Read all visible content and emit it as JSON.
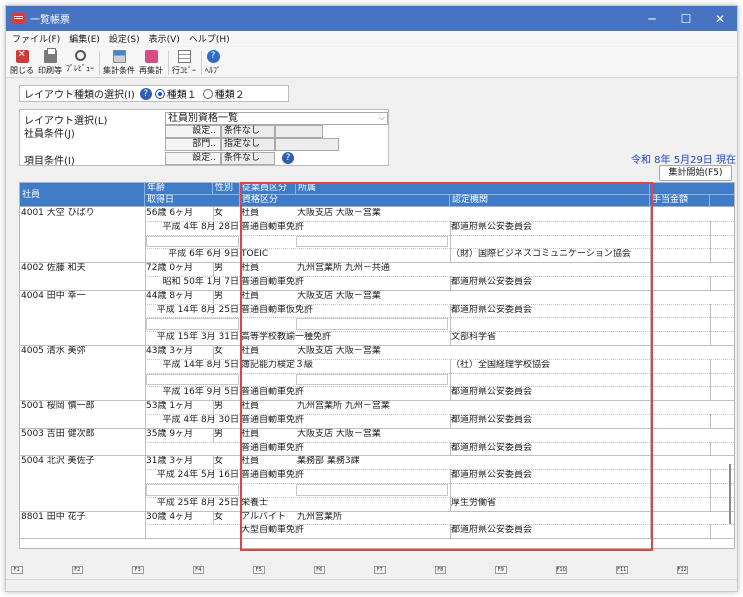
{
  "window": {
    "title": "一覧帳票",
    "controls": [
      "─",
      "☐",
      "✕"
    ]
  },
  "menu": [
    "ファイル(F)",
    "編集(E)",
    "設定(S)",
    "表示(V)",
    "ヘルプ(H)"
  ],
  "toolbar": [
    {
      "label": "閉じる",
      "icon": "close-icon"
    },
    {
      "label": "印刷等",
      "icon": "printer-icon"
    },
    {
      "label": "ﾌﾟﾚﾋﾞｭｰ",
      "icon": "magnifier-icon"
    },
    {
      "label": "集計条件",
      "icon": "summary-icon"
    },
    {
      "label": "再集計",
      "icon": "recalc-icon"
    },
    {
      "label": "行ｺﾋﾟｰ",
      "icon": "rowcopy-icon"
    },
    {
      "label": "ﾍﾙﾌﾟ",
      "icon": "help-icon"
    }
  ],
  "layout_type": {
    "label": "レイアウト種類の選択(I)",
    "help": "?",
    "options": [
      {
        "label": "種類１",
        "selected": true
      },
      {
        "label": "種類２",
        "selected": false
      }
    ]
  },
  "form": {
    "layout_select_label": "レイアウト選択(L)",
    "layout_select_value": "社員別資格一覧",
    "employee_cond_label": "社員条件(J)",
    "setting_btn": "設定..",
    "employee_cond_value": "条件なし",
    "dept_btn": "部門..",
    "dept_value": "指定なし",
    "item_cond_label": "項目条件(I)",
    "item_setting_btn": "設定..",
    "item_cond_value": "条件なし",
    "help": "?"
  },
  "date": "令和 8年 5月29日 現在",
  "run_button": "集計開始(F5)",
  "grid": {
    "headers": {
      "employee": "社員",
      "age": "年齢",
      "gender": "性別",
      "emp_type": "従業員区分",
      "affiliation": "所属",
      "acquired": "取得日",
      "qual": "資格区分",
      "authority": "認定機関",
      "allowance": "手当金額"
    },
    "rows": [
      {
        "employee": "4001 大空 ひばり",
        "age": "56歳  6ヶ月",
        "gender": "女",
        "type": "社員",
        "aff": "大阪支店 大阪－営業",
        "quals": [
          {
            "date": "平成  4年  8月 28日",
            "qual": "普通自動車免許",
            "auth": "都道府県公安委員会"
          },
          {
            "date": "",
            "qual": "",
            "auth": ""
          },
          {
            "date": "平成  6年  6月  9日",
            "qual": "TOEIC",
            "auth": "（財）国際ビジネスコミュニケーション協会"
          }
        ]
      },
      {
        "employee": "4002 佐藤 和夫",
        "age": "72歳  0ヶ月",
        "gender": "男",
        "type": "社員",
        "aff": "九州営業所 九州－共通",
        "quals": [
          {
            "date": "昭和 50年  1月  7日",
            "qual": "普通自動車免許",
            "auth": "都道府県公安委員会"
          }
        ]
      },
      {
        "employee": "4004 田中 幸一",
        "age": "44歳  8ヶ月",
        "gender": "男",
        "type": "社員",
        "aff": "大阪支店 大阪－営業",
        "quals": [
          {
            "date": "平成 14年  8月 25日",
            "qual": "普通自動車仮免許",
            "auth": "都道府県公安委員会"
          },
          {
            "date": "",
            "qual": "",
            "auth": ""
          },
          {
            "date": "平成 15年  3月 31日",
            "qual": "高等学校教諭一種免許",
            "auth": "文部科学省"
          }
        ]
      },
      {
        "employee": "4005 清水 美弥",
        "age": "43歳  3ヶ月",
        "gender": "女",
        "type": "社員",
        "aff": "大阪支店 大阪－営業",
        "quals": [
          {
            "date": "平成 14年  8月  5日",
            "qual": "簿記能力検定３級",
            "auth": "（社）全国経理学校協会"
          },
          {
            "date": "",
            "qual": "",
            "auth": ""
          },
          {
            "date": "平成 16年  9月  5日",
            "qual": "普通自動車免許",
            "auth": "都道府県公安委員会"
          }
        ]
      },
      {
        "employee": "5001 桜岡 慎一郎",
        "age": "53歳  1ヶ月",
        "gender": "男",
        "type": "社員",
        "aff": "九州営業所 九州－営業",
        "quals": [
          {
            "date": "平成  4年  8月 30日",
            "qual": "普通自動車免許",
            "auth": "都道府県公安委員会"
          }
        ]
      },
      {
        "employee": "5003 吉田 健次郎",
        "age": "35歳  9ヶ月",
        "gender": "男",
        "type": "社員",
        "aff": "大阪支店 大阪－営業",
        "quals": [
          {
            "date": "",
            "qual": "普通自動車免許",
            "auth": "都道府県公安委員会"
          }
        ]
      },
      {
        "employee": "5004 北沢 美佐子",
        "age": "31歳  3ヶ月",
        "gender": "女",
        "type": "社員",
        "aff": "業務部 業務3課",
        "quals": [
          {
            "date": "平成 24年  5月 16日",
            "qual": "普通自動車免許",
            "auth": "都道府県公安委員会"
          },
          {
            "date": "",
            "qual": "",
            "auth": ""
          },
          {
            "date": "平成 25年  8月 25日",
            "qual": "栄養士",
            "auth": "厚生労働省"
          }
        ]
      },
      {
        "employee": "8801 田中 花子",
        "age": "30歳  4ヶ月",
        "gender": "女",
        "type": "アルバイト",
        "aff": "九州営業所",
        "quals": [
          {
            "date": "",
            "qual": "大型自動車免許",
            "auth": "都道府県公安委員会"
          }
        ]
      }
    ]
  },
  "fkeys": [
    "F1",
    "F2",
    "F3",
    "F4",
    "F5",
    "F6",
    "F7",
    "F8",
    "F9",
    "F10",
    "F11",
    "F12"
  ]
}
